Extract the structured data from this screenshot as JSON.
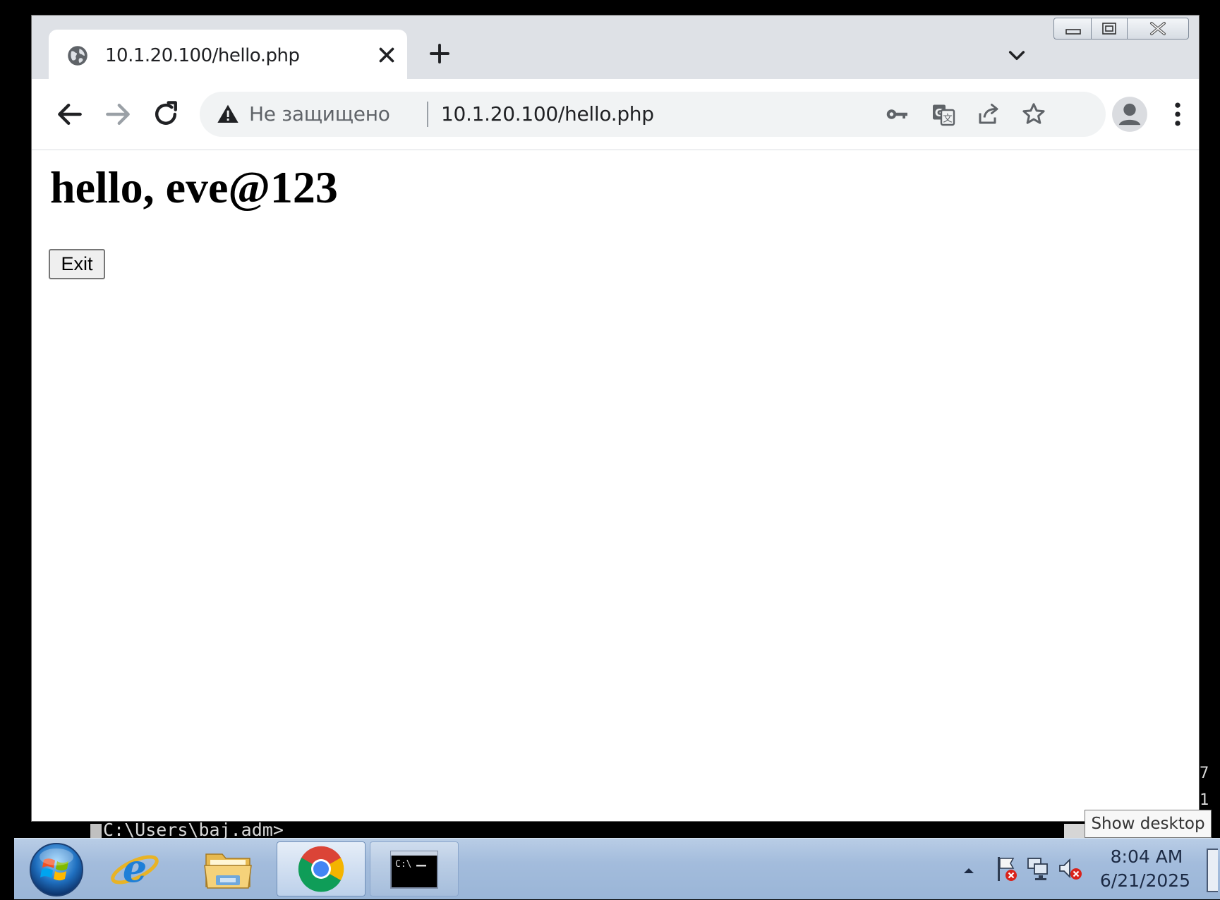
{
  "browser": {
    "tab": {
      "title": "10.1.20.100/hello.php"
    },
    "omnibox": {
      "security_label": "Не защищено",
      "url": "10.1.20.100/hello.php"
    },
    "icons": {
      "favicon": "globe-icon",
      "close": "close-icon",
      "new_tab": "plus-icon",
      "tab_search": "chevron-down-icon",
      "back": "arrow-left-icon",
      "forward": "arrow-right-icon",
      "reload": "reload-icon",
      "warning": "warning-triangle-icon",
      "passwords": "key-icon",
      "translate": "translate-icon",
      "share": "share-icon",
      "bookmark": "star-icon",
      "profile": "profile-icon",
      "menu": "kebab-menu-icon"
    }
  },
  "page": {
    "heading": "hello, eve@123",
    "exit_label": "Exit"
  },
  "console": {
    "prompt": "C:\\Users\\baj.adm>",
    "fragment_1": "7",
    "fragment_2": "1"
  },
  "tooltip": {
    "text": "Show desktop"
  },
  "taskbar": {
    "time": "8:04 AM",
    "date": "6/21/2025",
    "apps": [
      "start-orb-icon",
      "internet-explorer-icon",
      "file-explorer-icon",
      "chrome-icon",
      "command-prompt-icon"
    ]
  },
  "colors": {
    "tabstrip": "#dee1e6",
    "omnibox": "#f1f3f4",
    "taskbar": "#a3bcdc"
  }
}
